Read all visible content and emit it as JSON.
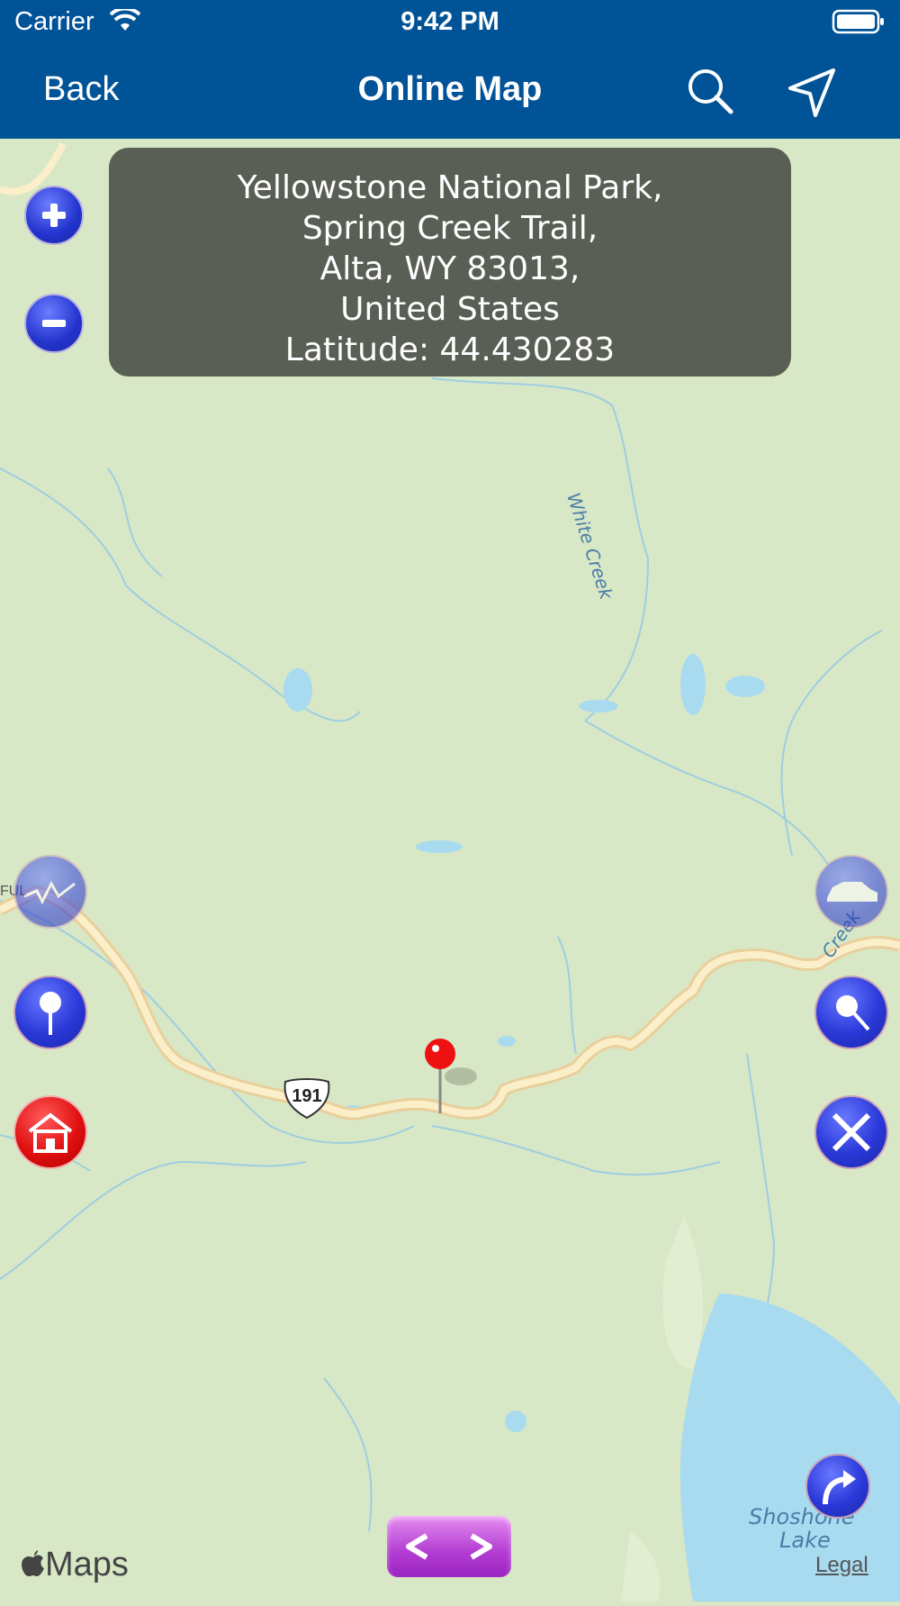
{
  "status_bar": {
    "carrier": "Carrier",
    "time": "9:42 PM"
  },
  "nav": {
    "back_label": "Back",
    "title": "Online Map",
    "search_icon": "search-icon",
    "location_icon": "location-arrow-icon"
  },
  "info_box": {
    "lines": [
      "Yellowstone National Park,",
      "Spring Creek Trail,",
      "Alta, WY  83013,",
      "United States",
      "Latitude: 44.430283"
    ]
  },
  "map": {
    "labels": {
      "white_creek": "White Creek",
      "creek_right": "Creek",
      "shoshone": "Shoshone",
      "lake": "Lake",
      "ful": "FUL",
      "route_shield": "191"
    },
    "brand": "Maps",
    "legal": "Legal"
  },
  "controls": {
    "zoom_in_icon": "plus-icon",
    "zoom_out_icon": "minus-icon",
    "left_buttons": [
      "signal-icon",
      "pin-icon",
      "house-icon"
    ],
    "right_buttons": [
      "car-icon",
      "pushpin-icon",
      "tools-icon",
      "turn-arrow-icon"
    ],
    "pager_icons": [
      "chevron-left-icon",
      "chevron-right-icon"
    ]
  },
  "colors": {
    "nav_blue": "#015398",
    "map_green": "#d8e8c6",
    "water": "#a8daf0",
    "road": "#fbe3b0",
    "info_bg": "#50544c"
  }
}
